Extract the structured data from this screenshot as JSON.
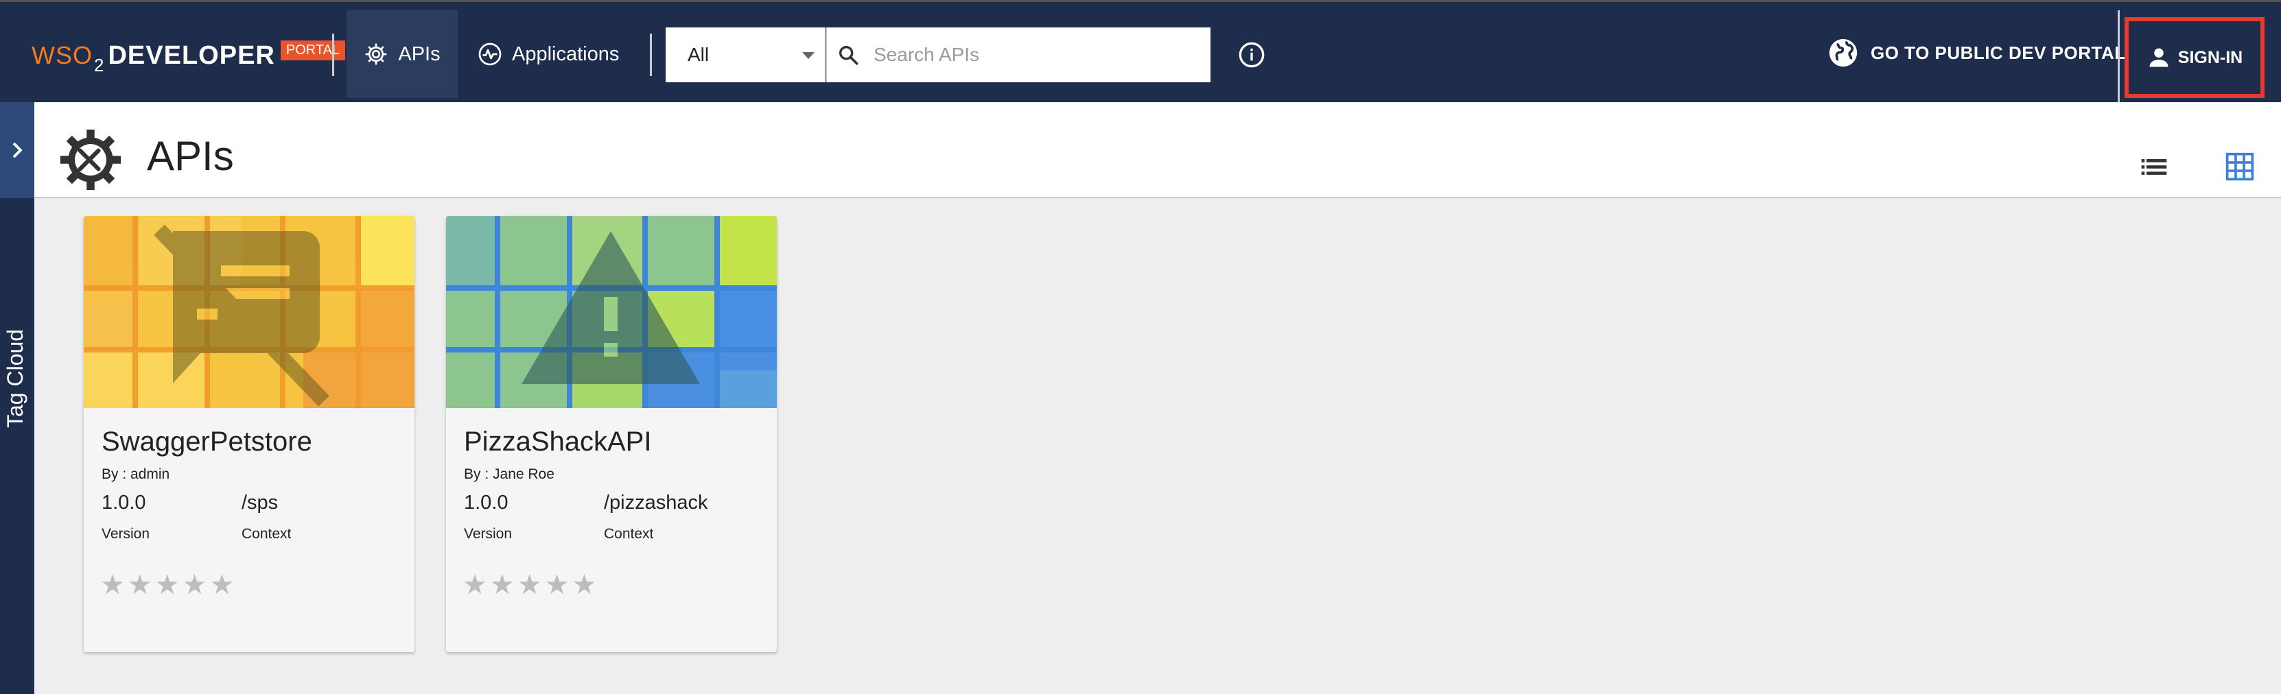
{
  "topbar": {
    "logo": {
      "wso": "WSO",
      "two": "2",
      "developer": "DEVELOPER",
      "portal": "PORTAL"
    },
    "nav": [
      {
        "label": "APIs",
        "icon": "gear-icon",
        "active": true
      },
      {
        "label": "Applications",
        "icon": "activity-icon",
        "active": false
      }
    ],
    "search": {
      "filter_value": "All",
      "placeholder": "Search APIs"
    },
    "public_portal_label": "GO TO PUBLIC DEV PORTAL",
    "signin_label": "SIGN-IN"
  },
  "sidebar": {
    "tag_cloud_label": "Tag Cloud"
  },
  "page": {
    "title": "APIs"
  },
  "apis": [
    {
      "name": "SwaggerPetstore",
      "by": "By : admin",
      "version": "1.0.0",
      "context": "/sps",
      "version_label": "Version",
      "context_label": "Context",
      "rating": 0,
      "rating_max": 5
    },
    {
      "name": "PizzaShackAPI",
      "by": "By : Jane Roe",
      "version": "1.0.0",
      "context": "/pizzashack",
      "version_label": "Version",
      "context_label": "Context",
      "rating": 0,
      "rating_max": 5
    }
  ],
  "colors": {
    "topbar": "#1e2d4b",
    "signin_highlight": "#e53a2d",
    "accent_orange": "#f47b20",
    "grid_active": "#3f7fdc"
  }
}
